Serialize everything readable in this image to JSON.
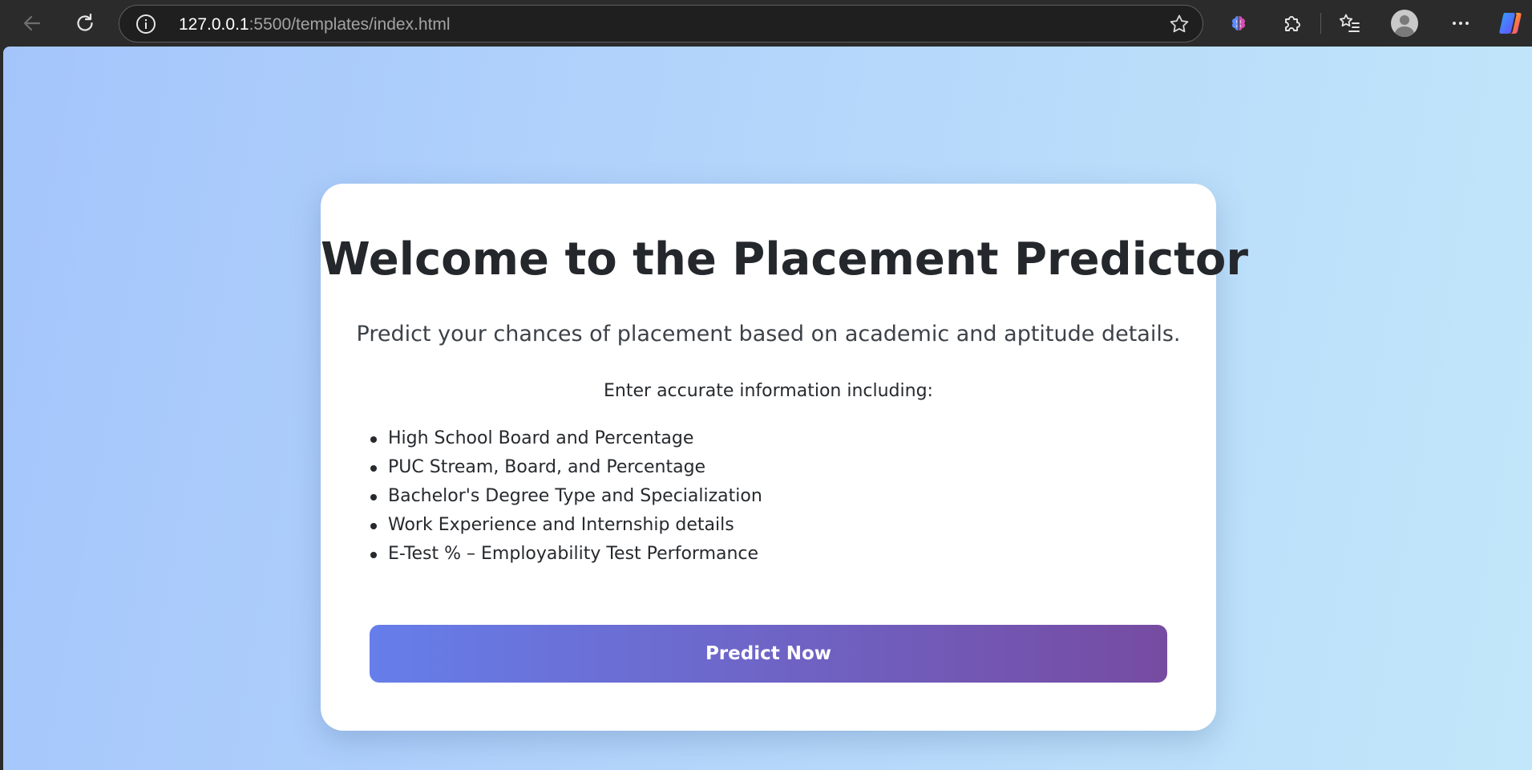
{
  "browser": {
    "url_host": "127.0.0.1",
    "url_rest": ":5500/templates/index.html",
    "icons": {
      "back": "back-arrow-icon",
      "reload": "reload-icon",
      "info": "info-icon",
      "favorite": "star-icon",
      "copilot_brain": "brain-icon",
      "extensions": "puzzle-icon",
      "favorites": "favorites-list-icon",
      "profile": "profile-avatar-icon",
      "more": "more-dots-icon",
      "copilot": "copilot-icon"
    }
  },
  "card": {
    "title": "Welcome to the Placement Predictor",
    "subtitle": "Predict your chances of placement based on academic and aptitude details.",
    "intro": "Enter accurate information including:",
    "items": [
      "High School Board and Percentage",
      "PUC Stream, Board, and Percentage",
      "Bachelor's Degree Type and Specialization",
      "Work Experience and Internship details",
      "E-Test % – Employability Test Performance"
    ],
    "button_label": "Predict Now"
  },
  "colors": {
    "button_gradient_start": "#667eea",
    "button_gradient_end": "#764ba2",
    "page_bg_start": "#a4c5fb",
    "page_bg_end": "#c2e7fa"
  }
}
